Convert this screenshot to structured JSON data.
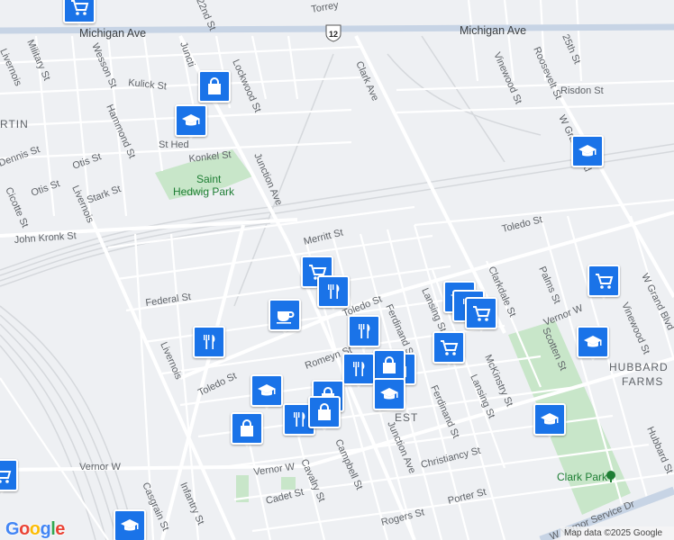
{
  "map": {
    "highway_shield": "12",
    "streets": [
      {
        "id": "michigan-ave-west",
        "label": "Michigan Ave"
      },
      {
        "id": "michigan-ave-east",
        "label": "Michigan Ave"
      },
      {
        "id": "clark-ave",
        "label": "Clark Ave"
      },
      {
        "id": "junction-ave-north",
        "label": "Junction Ave"
      },
      {
        "id": "junction-ave-south",
        "label": "Junction Ave"
      },
      {
        "id": "livernois-north",
        "label": "Livernois"
      },
      {
        "id": "livernois-mid",
        "label": "Livernois"
      },
      {
        "id": "livernois-south",
        "label": "Livernois"
      },
      {
        "id": "w-grand-blvd-north",
        "label": "W Grand Blvd"
      },
      {
        "id": "w-grand-blvd-south",
        "label": "W Grand Blvd"
      },
      {
        "id": "vernor-w-east",
        "label": "Vernor W"
      },
      {
        "id": "vernor-w-mid",
        "label": "Vernor W"
      },
      {
        "id": "vernor-w-west",
        "label": "Vernor W"
      },
      {
        "id": "toledo-st-east",
        "label": "Toledo St"
      },
      {
        "id": "toledo-st-mid",
        "label": "Toledo St"
      },
      {
        "id": "toledo-st-west",
        "label": "Toledo St"
      },
      {
        "id": "john-kronk-st",
        "label": "John Kronk St"
      },
      {
        "id": "federal-st",
        "label": "Federal St"
      },
      {
        "id": "romeyn-st",
        "label": "Romeyn St"
      },
      {
        "id": "merritt-st",
        "label": "Merritt St"
      },
      {
        "id": "konkel-st",
        "label": "Konkel St"
      },
      {
        "id": "kulick-st",
        "label": "Kulick St"
      },
      {
        "id": "lockwood-st",
        "label": "Lockwood St"
      },
      {
        "id": "wesson-st",
        "label": "Wesson St"
      },
      {
        "id": "military-st",
        "label": "Military St"
      },
      {
        "id": "hammond-st",
        "label": "Hammond St"
      },
      {
        "id": "dennis-st",
        "label": "Dennis St"
      },
      {
        "id": "otis-st-1",
        "label": "Otis St"
      },
      {
        "id": "otis-st-2",
        "label": "Otis St"
      },
      {
        "id": "stark-st",
        "label": "Stark St"
      },
      {
        "id": "cicotte-st",
        "label": "Cicotte St"
      },
      {
        "id": "vinewood-st-north",
        "label": "Vinewood St"
      },
      {
        "id": "vinewood-st-south",
        "label": "Vinewood St"
      },
      {
        "id": "roosevelt-st",
        "label": "Roosevelt St"
      },
      {
        "id": "25th-st",
        "label": "25th St"
      },
      {
        "id": "risdon-st",
        "label": "Risdon St"
      },
      {
        "id": "clarkdale-st",
        "label": "Clarkdale St"
      },
      {
        "id": "palms-st",
        "label": "Palms St"
      },
      {
        "id": "scotten-st",
        "label": "Scotten St"
      },
      {
        "id": "lansing-st-1",
        "label": "Lansing St"
      },
      {
        "id": "lansing-st-2",
        "label": "Lansing St"
      },
      {
        "id": "ferdinand-st-1",
        "label": "Ferdinand St"
      },
      {
        "id": "ferdinand-st-2",
        "label": "Ferdinand St"
      },
      {
        "id": "mckinstry-st",
        "label": "McKinstry St"
      },
      {
        "id": "christiancy-st",
        "label": "Christiancy St"
      },
      {
        "id": "porter-st",
        "label": "Porter St"
      },
      {
        "id": "rogers-st",
        "label": "Rogers St"
      },
      {
        "id": "campbell-st",
        "label": "Campbell St"
      },
      {
        "id": "cavalry-st",
        "label": "Cavalry St"
      },
      {
        "id": "cadet-st",
        "label": "Cadet St"
      },
      {
        "id": "casgrain-st",
        "label": "Casgrain St"
      },
      {
        "id": "infantry-st",
        "label": "Infantry St"
      },
      {
        "id": "hubbard-st",
        "label": "Hubbard St"
      },
      {
        "id": "torrey",
        "label": "Torrey"
      },
      {
        "id": "w-vernor-service-dr",
        "label": "W Vernor Service Dr"
      },
      {
        "id": "st-hed",
        "label": "St Hed"
      },
      {
        "id": "22nd-st",
        "label": "22nd St"
      },
      {
        "id": "junction-top",
        "label": "Juncti"
      }
    ],
    "areas": [
      {
        "id": "martin",
        "label": "RTIN"
      },
      {
        "id": "hubbard-farms-1",
        "label": "HUBBARD"
      },
      {
        "id": "hubbard-farms-2",
        "label": "FARMS"
      },
      {
        "id": "west",
        "label": "EST"
      }
    ],
    "parks": [
      {
        "id": "saint-hedwig-park-1",
        "label": "Saint"
      },
      {
        "id": "saint-hedwig-park-2",
        "label": "Hedwig Park"
      },
      {
        "id": "clark-park",
        "label": "Clark Park"
      }
    ],
    "pois": [
      {
        "id": "p1",
        "type": "grocery",
        "icon": "shopping-cart-icon"
      },
      {
        "id": "p2",
        "type": "shopping",
        "icon": "shopping-bag-icon"
      },
      {
        "id": "p3",
        "type": "school",
        "icon": "graduation-cap-icon"
      },
      {
        "id": "p4",
        "type": "school",
        "icon": "graduation-cap-icon"
      },
      {
        "id": "p5",
        "type": "grocery",
        "icon": "shopping-cart-icon"
      },
      {
        "id": "p6",
        "type": "grocery",
        "icon": "shopping-cart-icon"
      },
      {
        "id": "p7",
        "type": "restaurant",
        "icon": "fork-knife-icon"
      },
      {
        "id": "p8",
        "type": "cafe",
        "icon": "coffee-cup-icon"
      },
      {
        "id": "p9",
        "type": "restaurant",
        "icon": "fork-knife-icon"
      },
      {
        "id": "p10",
        "type": "restaurant",
        "icon": "fork-knife-icon"
      },
      {
        "id": "p11",
        "type": "school",
        "icon": "graduation-cap-icon"
      },
      {
        "id": "p12",
        "type": "restaurant",
        "icon": "fork-knife-icon"
      },
      {
        "id": "p13",
        "type": "grocery",
        "icon": "shopping-cart-icon"
      },
      {
        "id": "p14",
        "type": "grocery",
        "icon": "shopping-cart-icon"
      },
      {
        "id": "p15",
        "type": "school",
        "icon": "graduation-cap-icon"
      },
      {
        "id": "p16",
        "type": "shopping",
        "icon": "shopping-bag-icon"
      },
      {
        "id": "p17",
        "type": "shopping",
        "icon": "shopping-bag-icon"
      },
      {
        "id": "p18",
        "type": "restaurant",
        "icon": "fork-knife-icon"
      },
      {
        "id": "p19",
        "type": "school",
        "icon": "graduation-cap-icon"
      },
      {
        "id": "p20",
        "type": "shopping",
        "icon": "shopping-bag-icon"
      },
      {
        "id": "p21",
        "type": "school",
        "icon": "graduation-cap-icon"
      },
      {
        "id": "p22",
        "type": "shopping",
        "icon": "shopping-bag-icon"
      },
      {
        "id": "p23",
        "type": "restaurant",
        "icon": "fork-knife-icon"
      },
      {
        "id": "p24",
        "type": "shopping",
        "icon": "shopping-bag-icon"
      },
      {
        "id": "p25",
        "type": "school",
        "icon": "graduation-cap-icon"
      },
      {
        "id": "p26",
        "type": "school",
        "icon": "graduation-cap-icon"
      },
      {
        "id": "p27",
        "type": "grocery",
        "icon": "shopping-cart-icon"
      }
    ]
  },
  "footer": {
    "logo": "Google",
    "attribution": "Map data ©2025 Google"
  },
  "colors": {
    "marker": "#1a73e8",
    "park": "#c8e6c9",
    "road": "#ffffff",
    "highway": "#c7d4e5",
    "rail": "#d5d8dc",
    "background": "#eef0f3"
  }
}
